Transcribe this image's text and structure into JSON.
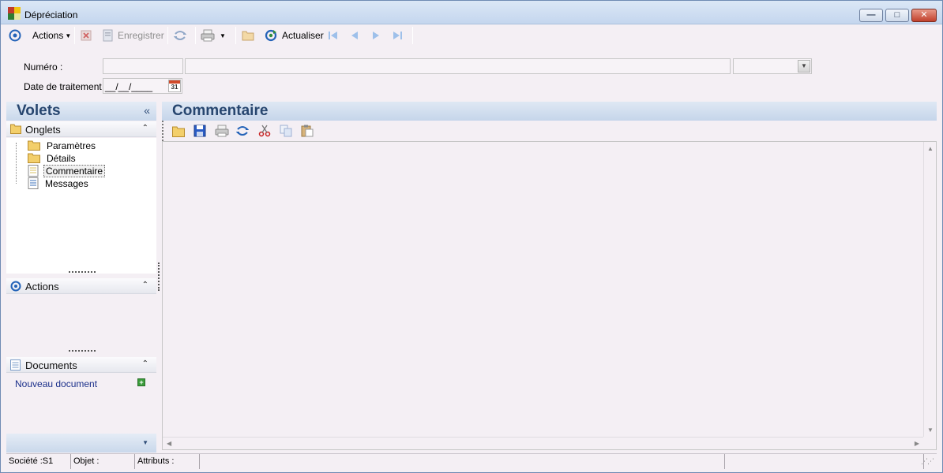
{
  "window": {
    "title": "Dépréciation",
    "minimize_glyph": "—",
    "maximize_glyph": "□",
    "close_glyph": "✕"
  },
  "toolbar": {
    "actions_label": "Actions",
    "save_label": "Enregistrer",
    "refresh_label": "Actualiser"
  },
  "form": {
    "numero_label": "Numéro :",
    "numero_value": "",
    "libelle_value": "",
    "date_label": "Date de traitement :",
    "date_value": "__/__/____",
    "calendar_day": "31"
  },
  "volets": {
    "title": "Volets",
    "collapse_glyph": "«",
    "onglets": {
      "title": "Onglets",
      "items": [
        {
          "label": "Paramètres",
          "icon": "folder-icon"
        },
        {
          "label": "Détails",
          "icon": "folder-icon"
        },
        {
          "label": "Commentaire",
          "icon": "document-icon",
          "selected": true
        },
        {
          "label": "Messages",
          "icon": "document-icon"
        }
      ]
    },
    "actions": {
      "title": "Actions"
    },
    "documents": {
      "title": "Documents",
      "new_document_label": "Nouveau document"
    },
    "expand_glyph": "⌃",
    "dropdown_glyph": "▼"
  },
  "main": {
    "title": "Commentaire"
  },
  "statusbar": {
    "societe": "Société :S1",
    "objet": "Objet :",
    "attributs": "Attributs :"
  },
  "colors": {
    "header_text": "#27466f",
    "link": "#1a2f8a",
    "window_bg": "#f4eff4"
  }
}
